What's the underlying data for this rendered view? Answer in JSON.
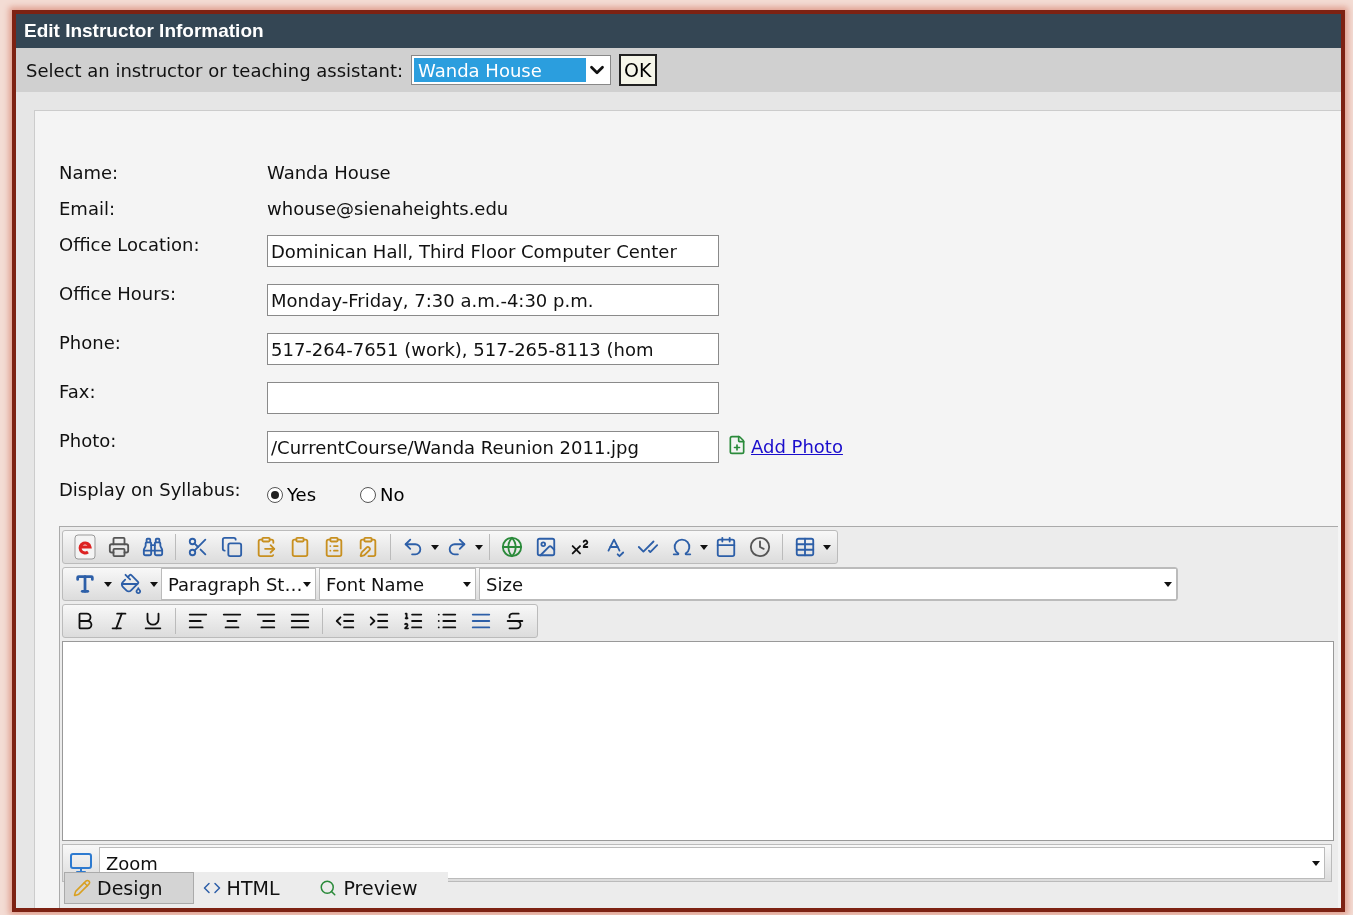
{
  "window": {
    "title": "Edit Instructor Information"
  },
  "selector": {
    "label": "Select an instructor or teaching assistant:",
    "value": "Wanda House",
    "button": "OK"
  },
  "fields": [
    {
      "kind": "text",
      "label": "Name:",
      "value": "Wanda House"
    },
    {
      "kind": "text",
      "label": "Email:",
      "value": "whouse@sienaheights.edu"
    },
    {
      "kind": "input",
      "label": "Office Location:",
      "value": "Dominican Hall, Third Floor Computer Center"
    },
    {
      "kind": "input",
      "label": "Office Hours:",
      "value": "Monday-Friday, 7:30 a.m.-4:30 p.m."
    },
    {
      "kind": "input",
      "label": "Phone:",
      "value": "517-264-7651 (work), 517-265-8113 (hom"
    },
    {
      "kind": "input",
      "label": "Fax:"
    },
    {
      "kind": "photo",
      "label": "Photo:",
      "value": "/CurrentCourse/Wanda Reunion 2011.jpg",
      "link": "Add Photo"
    },
    {
      "kind": "radio",
      "label": "Display on Syllabus:",
      "options": [
        {
          "label": "Yes",
          "selected": true
        },
        {
          "label": "No",
          "selected": false
        }
      ]
    }
  ],
  "editor": {
    "paragraph_style": "Paragraph St…",
    "font_name": "Font Name",
    "size": "Size",
    "zoom": "Zoom",
    "tabs": [
      {
        "label": "Design",
        "selected": true
      },
      {
        "label": "HTML",
        "selected": false
      },
      {
        "label": "Preview",
        "selected": false
      }
    ]
  }
}
